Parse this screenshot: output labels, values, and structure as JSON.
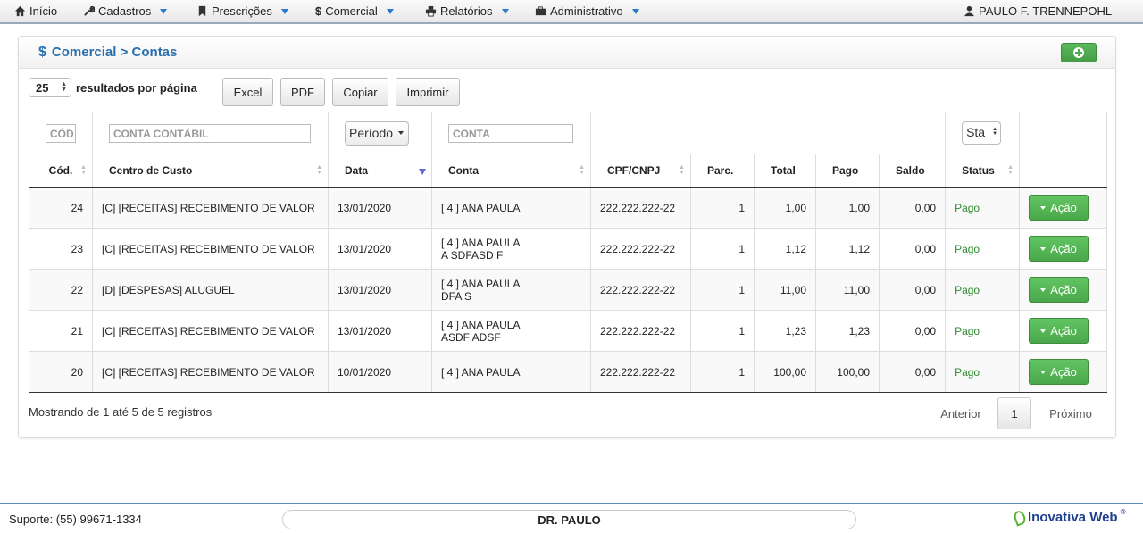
{
  "nav": {
    "home": "Início",
    "cadastros": "Cadastros",
    "prescricoes": "Prescrições",
    "comercial": "Comercial",
    "relatorios": "Relatórios",
    "administrativo": "Administrativo",
    "user": "PAULO F. TRENNEPOHL"
  },
  "panel": {
    "title_icon": "$",
    "title": "Comercial > Contas"
  },
  "toolbar": {
    "page_size": "25",
    "page_size_label": "resultados por página",
    "excel": "Excel",
    "pdf": "PDF",
    "copiar": "Copiar",
    "imprimir": "Imprimir"
  },
  "filters": {
    "cod": "CÓD",
    "conta_contabil": "CONTA CONTÁBIL",
    "periodo": "Período",
    "conta": "CONTA",
    "status": "Sta"
  },
  "columns": {
    "cod": "Cód.",
    "centro": "Centro de Custo",
    "data": "Data",
    "conta": "Conta",
    "cpf": "CPF/CNPJ",
    "parc": "Parc.",
    "total": "Total",
    "pago": "Pago",
    "saldo": "Saldo",
    "status": "Status"
  },
  "rows": [
    {
      "cod": "24",
      "centro": "[C] [RECEITAS] RECEBIMENTO DE VALOR",
      "data": "13/01/2020",
      "conta1": "[ 4 ] ANA PAULA",
      "conta2": "",
      "cpf": "222.222.222-22",
      "parc": "1",
      "total": "1,00",
      "pago": "1,00",
      "saldo": "0,00",
      "status": "Pago",
      "acao": "Ação"
    },
    {
      "cod": "23",
      "centro": "[C] [RECEITAS] RECEBIMENTO DE VALOR",
      "data": "13/01/2020",
      "conta1": "[ 4 ] ANA PAULA",
      "conta2": "A SDFASD F",
      "cpf": "222.222.222-22",
      "parc": "1",
      "total": "1,12",
      "pago": "1,12",
      "saldo": "0,00",
      "status": "Pago",
      "acao": "Ação"
    },
    {
      "cod": "22",
      "centro": "[D] [DESPESAS] ALUGUEL",
      "data": "13/01/2020",
      "conta1": "[ 4 ] ANA PAULA",
      "conta2": "DFA S",
      "cpf": "222.222.222-22",
      "parc": "1",
      "total": "11,00",
      "pago": "11,00",
      "saldo": "0,00",
      "status": "Pago",
      "acao": "Ação"
    },
    {
      "cod": "21",
      "centro": "[C] [RECEITAS] RECEBIMENTO DE VALOR",
      "data": "13/01/2020",
      "conta1": "[ 4 ] ANA PAULA",
      "conta2": "ASDF ADSF",
      "cpf": "222.222.222-22",
      "parc": "1",
      "total": "1,23",
      "pago": "1,23",
      "saldo": "0,00",
      "status": "Pago",
      "acao": "Ação"
    },
    {
      "cod": "20",
      "centro": "[C] [RECEITAS] RECEBIMENTO DE VALOR",
      "data": "10/01/2020",
      "conta1": "[ 4 ] ANA PAULA",
      "conta2": "",
      "cpf": "222.222.222-22",
      "parc": "1",
      "total": "100,00",
      "pago": "100,00",
      "saldo": "0,00",
      "status": "Pago",
      "acao": "Ação"
    }
  ],
  "table_info": "Mostrando de 1 até 5 de 5 registros",
  "pagination": {
    "prev": "Anterior",
    "current": "1",
    "next": "Próximo"
  },
  "footer": {
    "support": "Suporte: (55) 99671-1334",
    "user_name": "DR. PAULO",
    "logo": "Inovativa Web",
    "logo_mark": "®"
  },
  "colors": {
    "accent": "#2a6fb0",
    "success": "#5cb85c",
    "status_pago": "#2e8b2e"
  },
  "icons": [
    "home-icon",
    "wrench-icon",
    "bookmark-icon",
    "dollar-icon",
    "printer-icon",
    "briefcase-icon",
    "user-icon",
    "plus-circle-icon",
    "caret-down-icon"
  ]
}
